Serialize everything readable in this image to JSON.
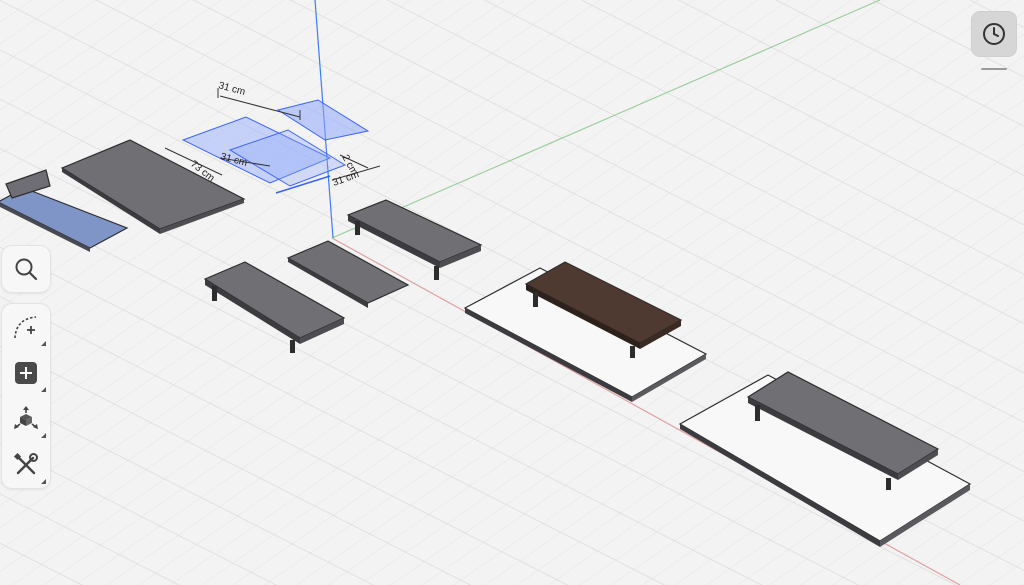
{
  "viewport": {
    "dimensions": {
      "top_width": "31 cm",
      "middle_width": "31 cm",
      "depth_left": "73 cm",
      "height_label": "2 cm",
      "right_width": "31 cm"
    }
  },
  "toolbar": {
    "tools": [
      {
        "id": "search",
        "icon": "search-icon"
      },
      {
        "id": "draw",
        "icon": "curve-plus-icon"
      },
      {
        "id": "add",
        "icon": "plus-square-icon"
      },
      {
        "id": "transform",
        "icon": "transform-icon"
      },
      {
        "id": "tools",
        "icon": "wrench-screwdriver-icon"
      }
    ]
  },
  "history": {
    "icon": "clock-icon"
  },
  "colors": {
    "grid_bg": "#f3f3f3",
    "grid_line": "#dcdcdc",
    "axis_x": "#e0a0a0",
    "axis_y": "#9ccf9c",
    "axis_z": "#3b7bff",
    "table_dark": "#6f6f74",
    "table_brown": "#4f3a32",
    "selection_blue": "#7f9bff"
  }
}
